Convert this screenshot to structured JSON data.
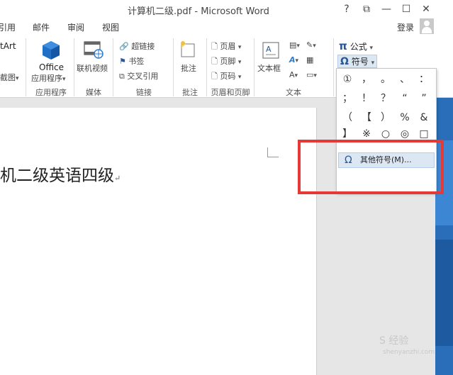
{
  "window": {
    "title": "计算机二级.pdf - Microsoft Word",
    "help": "?",
    "restore_icon": "⧉",
    "minimize": "—",
    "maximize": "☐",
    "close": "✕"
  },
  "menu": {
    "tabs": [
      "引用",
      "邮件",
      "审阅",
      "视图"
    ],
    "login": "登录"
  },
  "ribbon": {
    "smartart_fragment": "tArt",
    "chart_fragment": "截图",
    "office_label": "Office",
    "office_sub": "应用程序",
    "online_video": "联机视频",
    "hyperlink": "超链接",
    "bookmark": "书签",
    "crossref": "交叉引用",
    "comment": "批注",
    "header": "页眉",
    "footer": "页脚",
    "page_number": "页码",
    "textbox": "文本框",
    "equation": "公式",
    "symbol": "符号",
    "groups": {
      "apps": "应用程序",
      "media": "媒体",
      "links": "链接",
      "comments": "批注",
      "header_footer": "页眉和页脚",
      "text": "文本"
    }
  },
  "symbol_menu": {
    "symbols": [
      "①",
      "，",
      "。",
      "、",
      "：",
      "；",
      "！",
      "？",
      "“",
      "”",
      "（",
      "【",
      "）",
      "%",
      "&",
      "】",
      "※",
      "○",
      "◎",
      "□"
    ],
    "more_symbols": "其他符号(M)..."
  },
  "document": {
    "text": "机二级英语四级",
    "para_mark": "↵"
  },
  "watermark": {
    "line1": "S 经验",
    "line2": "shenyanzhi.com"
  }
}
